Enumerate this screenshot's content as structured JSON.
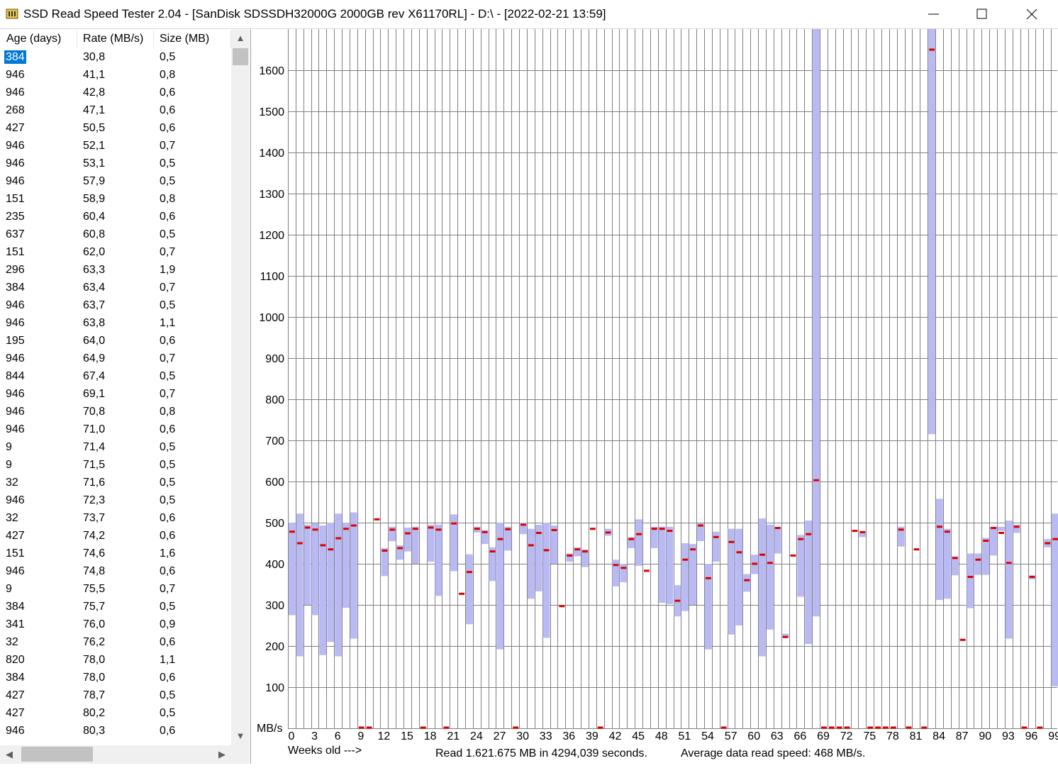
{
  "window": {
    "title": "SSD Read Speed Tester 2.04 - [SanDisk SDSSDH32000G 2000GB rev X61170RL] - D:\\ - [2022-02-21 13:59]"
  },
  "table": {
    "columns": [
      "Age (days)",
      "Rate (MB/s)",
      "Size (MB)"
    ],
    "selected_row": 0,
    "rows": [
      [
        "384",
        "30,8",
        "0,5"
      ],
      [
        "946",
        "41,1",
        "0,8"
      ],
      [
        "946",
        "42,8",
        "0,6"
      ],
      [
        "268",
        "47,1",
        "0,6"
      ],
      [
        "427",
        "50,5",
        "0,6"
      ],
      [
        "946",
        "52,1",
        "0,7"
      ],
      [
        "946",
        "53,1",
        "0,5"
      ],
      [
        "946",
        "57,9",
        "0,5"
      ],
      [
        "151",
        "58,9",
        "0,8"
      ],
      [
        "235",
        "60,4",
        "0,6"
      ],
      [
        "637",
        "60,8",
        "0,5"
      ],
      [
        "151",
        "62,0",
        "0,7"
      ],
      [
        "296",
        "63,3",
        "1,9"
      ],
      [
        "384",
        "63,4",
        "0,7"
      ],
      [
        "946",
        "63,7",
        "0,5"
      ],
      [
        "946",
        "63,8",
        "1,1"
      ],
      [
        "195",
        "64,0",
        "0,6"
      ],
      [
        "946",
        "64,9",
        "0,7"
      ],
      [
        "844",
        "67,4",
        "0,5"
      ],
      [
        "946",
        "69,1",
        "0,7"
      ],
      [
        "946",
        "70,8",
        "0,8"
      ],
      [
        "946",
        "71,0",
        "0,6"
      ],
      [
        "9",
        "71,4",
        "0,5"
      ],
      [
        "9",
        "71,5",
        "0,5"
      ],
      [
        "32",
        "71,6",
        "0,5"
      ],
      [
        "946",
        "72,3",
        "0,5"
      ],
      [
        "32",
        "73,7",
        "0,6"
      ],
      [
        "427",
        "74,2",
        "0,6"
      ],
      [
        "151",
        "74,6",
        "1,6"
      ],
      [
        "946",
        "74,8",
        "0,6"
      ],
      [
        "9",
        "75,5",
        "0,7"
      ],
      [
        "384",
        "75,7",
        "0,5"
      ],
      [
        "341",
        "76,0",
        "0,9"
      ],
      [
        "32",
        "76,2",
        "0,6"
      ],
      [
        "820",
        "78,0",
        "1,1"
      ],
      [
        "384",
        "78,0",
        "0,6"
      ],
      [
        "427",
        "78,7",
        "0,5"
      ],
      [
        "427",
        "80,2",
        "0,5"
      ],
      [
        "946",
        "80,3",
        "0,6"
      ]
    ]
  },
  "chart_data": {
    "type": "bar",
    "description": "Per-week read speed range (low-high) with average marker",
    "ylabel": "MB/s",
    "xlabel": "Weeks old --->",
    "ylim": [
      0,
      1700
    ],
    "yticks": [
      100,
      200,
      300,
      400,
      500,
      600,
      700,
      800,
      900,
      1000,
      1100,
      1200,
      1300,
      1400,
      1500,
      1600
    ],
    "xticks": [
      0,
      3,
      6,
      9,
      12,
      15,
      18,
      21,
      24,
      27,
      30,
      33,
      36,
      39,
      42,
      45,
      48,
      51,
      54,
      57,
      60,
      63,
      66,
      69,
      72,
      75,
      78,
      81,
      84,
      87,
      90,
      93,
      96,
      99
    ],
    "grid": true,
    "weeks": [
      {
        "w": 0,
        "lo": 275,
        "hi": 500,
        "avg": 478
      },
      {
        "w": 1,
        "lo": 175,
        "hi": 522,
        "avg": 450
      },
      {
        "w": 2,
        "lo": 300,
        "hi": 495,
        "avg": 488
      },
      {
        "w": 3,
        "lo": 275,
        "hi": 498,
        "avg": 483
      },
      {
        "w": 4,
        "lo": 178,
        "hi": 493,
        "avg": 445
      },
      {
        "w": 5,
        "lo": 210,
        "hi": 500,
        "avg": 435
      },
      {
        "w": 6,
        "lo": 175,
        "hi": 522,
        "avg": 462
      },
      {
        "w": 7,
        "lo": 293,
        "hi": 500,
        "avg": 485
      },
      {
        "w": 8,
        "lo": 218,
        "hi": 525,
        "avg": 493
      },
      {
        "w": 9,
        "lo": 0,
        "hi": 0,
        "avg": 0
      },
      {
        "w": 10,
        "lo": 0,
        "hi": 0,
        "avg": 0
      },
      {
        "w": 11,
        "lo": 508,
        "hi": 508,
        "avg": 508
      },
      {
        "w": 12,
        "lo": 370,
        "hi": 438,
        "avg": 432
      },
      {
        "w": 13,
        "lo": 455,
        "hi": 490,
        "avg": 483
      },
      {
        "w": 14,
        "lo": 410,
        "hi": 445,
        "avg": 438
      },
      {
        "w": 15,
        "lo": 430,
        "hi": 488,
        "avg": 474
      },
      {
        "w": 16,
        "lo": 400,
        "hi": 490,
        "avg": 485
      },
      {
        "w": 17,
        "lo": 0,
        "hi": 0,
        "avg": 0
      },
      {
        "w": 18,
        "lo": 405,
        "hi": 495,
        "avg": 488
      },
      {
        "w": 19,
        "lo": 322,
        "hi": 495,
        "avg": 483
      },
      {
        "w": 20,
        "lo": 0,
        "hi": 0,
        "avg": 0
      },
      {
        "w": 21,
        "lo": 382,
        "hi": 520,
        "avg": 498
      },
      {
        "w": 22,
        "lo": 327,
        "hi": 327,
        "avg": 327
      },
      {
        "w": 23,
        "lo": 253,
        "hi": 423,
        "avg": 380
      },
      {
        "w": 24,
        "lo": 476,
        "hi": 490,
        "avg": 485
      },
      {
        "w": 25,
        "lo": 448,
        "hi": 482,
        "avg": 477
      },
      {
        "w": 26,
        "lo": 358,
        "hi": 440,
        "avg": 430
      },
      {
        "w": 27,
        "lo": 192,
        "hi": 500,
        "avg": 460
      },
      {
        "w": 28,
        "lo": 432,
        "hi": 490,
        "avg": 484
      },
      {
        "w": 29,
        "lo": 0,
        "hi": 0,
        "avg": 0
      },
      {
        "w": 30,
        "lo": 472,
        "hi": 500,
        "avg": 495
      },
      {
        "w": 31,
        "lo": 315,
        "hi": 485,
        "avg": 445
      },
      {
        "w": 32,
        "lo": 333,
        "hi": 495,
        "avg": 475
      },
      {
        "w": 33,
        "lo": 220,
        "hi": 500,
        "avg": 433
      },
      {
        "w": 34,
        "lo": 400,
        "hi": 493,
        "avg": 482
      },
      {
        "w": 35,
        "lo": 297,
        "hi": 297,
        "avg": 297
      },
      {
        "w": 36,
        "lo": 405,
        "hi": 425,
        "avg": 420
      },
      {
        "w": 37,
        "lo": 418,
        "hi": 440,
        "avg": 435
      },
      {
        "w": 38,
        "lo": 392,
        "hi": 435,
        "avg": 430
      },
      {
        "w": 39,
        "lo": 485,
        "hi": 485,
        "avg": 485
      },
      {
        "w": 40,
        "lo": 0,
        "hi": 0,
        "avg": 0
      },
      {
        "w": 41,
        "lo": 468,
        "hi": 485,
        "avg": 476
      },
      {
        "w": 42,
        "lo": 345,
        "hi": 410,
        "avg": 397
      },
      {
        "w": 43,
        "lo": 355,
        "hi": 400,
        "avg": 390
      },
      {
        "w": 44,
        "lo": 438,
        "hi": 465,
        "avg": 460
      },
      {
        "w": 45,
        "lo": 395,
        "hi": 508,
        "avg": 472
      },
      {
        "w": 46,
        "lo": 383,
        "hi": 383,
        "avg": 383
      },
      {
        "w": 47,
        "lo": 438,
        "hi": 490,
        "avg": 485
      },
      {
        "w": 48,
        "lo": 305,
        "hi": 490,
        "avg": 485
      },
      {
        "w": 49,
        "lo": 302,
        "hi": 490,
        "avg": 480
      },
      {
        "w": 50,
        "lo": 272,
        "hi": 348,
        "avg": 310
      },
      {
        "w": 51,
        "lo": 285,
        "hi": 450,
        "avg": 410
      },
      {
        "w": 52,
        "lo": 300,
        "hi": 448,
        "avg": 435
      },
      {
        "w": 53,
        "lo": 455,
        "hi": 498,
        "avg": 493
      },
      {
        "w": 54,
        "lo": 192,
        "hi": 400,
        "avg": 365
      },
      {
        "w": 55,
        "lo": 405,
        "hi": 478,
        "avg": 465
      },
      {
        "w": 56,
        "lo": 0,
        "hi": 0,
        "avg": 0
      },
      {
        "w": 57,
        "lo": 228,
        "hi": 485,
        "avg": 453
      },
      {
        "w": 58,
        "lo": 250,
        "hi": 485,
        "avg": 428
      },
      {
        "w": 59,
        "lo": 332,
        "hi": 375,
        "avg": 360
      },
      {
        "w": 60,
        "lo": 375,
        "hi": 422,
        "avg": 400
      },
      {
        "w": 61,
        "lo": 175,
        "hi": 510,
        "avg": 422
      },
      {
        "w": 62,
        "lo": 240,
        "hi": 495,
        "avg": 402
      },
      {
        "w": 63,
        "lo": 425,
        "hi": 490,
        "avg": 487
      },
      {
        "w": 64,
        "lo": 220,
        "hi": 230,
        "avg": 222
      },
      {
        "w": 65,
        "lo": 420,
        "hi": 420,
        "avg": 420
      },
      {
        "w": 66,
        "lo": 320,
        "hi": 470,
        "avg": 460
      },
      {
        "w": 67,
        "lo": 205,
        "hi": 505,
        "avg": 472
      },
      {
        "w": 68,
        "lo": 272,
        "hi": 1700,
        "avg": 603
      },
      {
        "w": 69,
        "lo": 0,
        "hi": 0,
        "avg": 0
      },
      {
        "w": 70,
        "lo": 0,
        "hi": 0,
        "avg": 0
      },
      {
        "w": 71,
        "lo": 0,
        "hi": 0,
        "avg": 0
      },
      {
        "w": 72,
        "lo": 0,
        "hi": 0,
        "avg": 0
      },
      {
        "w": 73,
        "lo": 480,
        "hi": 480,
        "avg": 480
      },
      {
        "w": 74,
        "lo": 465,
        "hi": 478,
        "avg": 477
      },
      {
        "w": 75,
        "lo": 0,
        "hi": 0,
        "avg": 0
      },
      {
        "w": 76,
        "lo": 0,
        "hi": 0,
        "avg": 0
      },
      {
        "w": 77,
        "lo": 0,
        "hi": 0,
        "avg": 0
      },
      {
        "w": 78,
        "lo": 0,
        "hi": 0,
        "avg": 0
      },
      {
        "w": 79,
        "lo": 442,
        "hi": 490,
        "avg": 483
      },
      {
        "w": 80,
        "lo": 0,
        "hi": 0,
        "avg": 0
      },
      {
        "w": 81,
        "lo": 435,
        "hi": 435,
        "avg": 435
      },
      {
        "w": 82,
        "lo": 0,
        "hi": 0,
        "avg": 0
      },
      {
        "w": 83,
        "lo": 715,
        "hi": 1700,
        "avg": 1650
      },
      {
        "w": 84,
        "lo": 312,
        "hi": 558,
        "avg": 490
      },
      {
        "w": 85,
        "lo": 315,
        "hi": 485,
        "avg": 478
      },
      {
        "w": 86,
        "lo": 372,
        "hi": 418,
        "avg": 414
      },
      {
        "w": 87,
        "lo": 215,
        "hi": 215,
        "avg": 215
      },
      {
        "w": 88,
        "lo": 292,
        "hi": 425,
        "avg": 368
      },
      {
        "w": 89,
        "lo": 373,
        "hi": 425,
        "avg": 410
      },
      {
        "w": 90,
        "lo": 373,
        "hi": 463,
        "avg": 456
      },
      {
        "w": 91,
        "lo": 420,
        "hi": 490,
        "avg": 487
      },
      {
        "w": 92,
        "lo": 490,
        "hi": 480,
        "avg": 475
      },
      {
        "w": 93,
        "lo": 218,
        "hi": 505,
        "avg": 402
      },
      {
        "w": 94,
        "lo": 475,
        "hi": 495,
        "avg": 490
      },
      {
        "w": 95,
        "lo": 0,
        "hi": 0,
        "avg": 0
      },
      {
        "w": 96,
        "lo": 362,
        "hi": 372,
        "avg": 368
      },
      {
        "w": 97,
        "lo": 0,
        "hi": 0,
        "avg": 0
      },
      {
        "w": 98,
        "lo": 440,
        "hi": 460,
        "avg": 450
      },
      {
        "w": 99,
        "lo": 102,
        "hi": 522,
        "avg": 460
      }
    ],
    "summary_read": "Read 1.621.675 MB in 4294,039 seconds.",
    "summary_avg": "Average data read speed: 468 MB/s."
  },
  "colors": {
    "range": "#b9b9f3",
    "avg": "#dd0000",
    "grid": "#808080",
    "selection": "#0078d7"
  }
}
